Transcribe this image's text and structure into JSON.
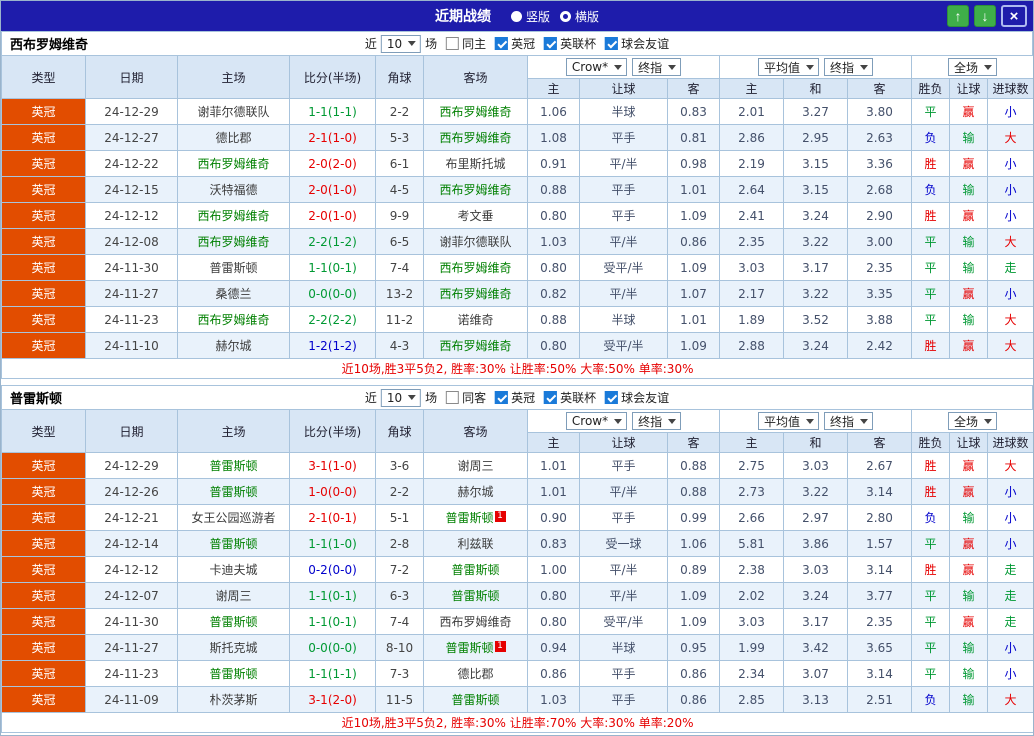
{
  "titlebar": {
    "title": "近期战绩",
    "options": [
      {
        "label": "竖版",
        "selected": false
      },
      {
        "label": "横版",
        "selected": true
      }
    ],
    "icons": {
      "up": "↑",
      "down": "↓",
      "close": "×"
    }
  },
  "table_header": {
    "type": "类型",
    "date": "日期",
    "home": "主场",
    "score": "比分(半场)",
    "corner": "角球",
    "away": "客场",
    "selects": {
      "asia_source": "Crow*",
      "asia_final": "终指",
      "euro_source": "平均值",
      "euro_final": "终指",
      "scope": "全场"
    },
    "sub": [
      "主",
      "让球",
      "客",
      "主",
      "和",
      "客",
      "胜负",
      "让球",
      "进球数"
    ]
  },
  "colors": {
    "titlebar_bg": "#1e1cab",
    "league_bg": "#e24d00",
    "header_bg": "#d8e6f5",
    "row_alt_bg": "#e9f2fb",
    "team_highlight": "#008000",
    "win_red": "#e60000",
    "draw_green": "#009933",
    "loss_blue": "#0000cc",
    "button_green": "#3fae49"
  },
  "sections": [
    {
      "team": "西布罗姆维奇",
      "filter": {
        "near": "近",
        "count": "10",
        "games": "场",
        "checkboxes": [
          {
            "label": "同主",
            "checked": false
          },
          {
            "label": "英冠",
            "checked": true
          },
          {
            "label": "英联杯",
            "checked": true
          },
          {
            "label": "球会友谊",
            "checked": true
          }
        ]
      },
      "rows": [
        {
          "league": "英冠",
          "date": "24-12-29",
          "home": "谢菲尔德联队",
          "home_hl": false,
          "score": "1-1(1-1)",
          "score_c": "g",
          "corner": "2-2",
          "away": "西布罗姆维奇",
          "away_hl": true,
          "asia": [
            "1.06",
            "半球",
            "0.83"
          ],
          "euro": [
            "2.01",
            "3.27",
            "3.80"
          ],
          "wdl": "平",
          "wdl_c": "g",
          "let": "赢",
          "let_c": "r",
          "goal": "小",
          "goal_c": "b"
        },
        {
          "league": "英冠",
          "date": "24-12-27",
          "home": "德比郡",
          "home_hl": false,
          "score": "2-1(1-0)",
          "score_c": "r",
          "corner": "5-3",
          "away": "西布罗姆维奇",
          "away_hl": true,
          "asia": [
            "1.08",
            "平手",
            "0.81"
          ],
          "euro": [
            "2.86",
            "2.95",
            "2.63"
          ],
          "wdl": "负",
          "wdl_c": "b",
          "let": "输",
          "let_c": "g",
          "goal": "大",
          "goal_c": "r"
        },
        {
          "league": "英冠",
          "date": "24-12-22",
          "home": "西布罗姆维奇",
          "home_hl": true,
          "score": "2-0(2-0)",
          "score_c": "r",
          "corner": "6-1",
          "away": "布里斯托城",
          "away_hl": false,
          "asia": [
            "0.91",
            "平/半",
            "0.98"
          ],
          "euro": [
            "2.19",
            "3.15",
            "3.36"
          ],
          "wdl": "胜",
          "wdl_c": "r",
          "let": "赢",
          "let_c": "r",
          "goal": "小",
          "goal_c": "b"
        },
        {
          "league": "英冠",
          "date": "24-12-15",
          "home": "沃特福德",
          "home_hl": false,
          "score": "2-0(1-0)",
          "score_c": "r",
          "corner": "4-5",
          "away": "西布罗姆维奇",
          "away_hl": true,
          "asia": [
            "0.88",
            "平手",
            "1.01"
          ],
          "euro": [
            "2.64",
            "3.15",
            "2.68"
          ],
          "wdl": "负",
          "wdl_c": "b",
          "let": "输",
          "let_c": "g",
          "goal": "小",
          "goal_c": "b"
        },
        {
          "league": "英冠",
          "date": "24-12-12",
          "home": "西布罗姆维奇",
          "home_hl": true,
          "score": "2-0(1-0)",
          "score_c": "r",
          "corner": "9-9",
          "away": "考文垂",
          "away_hl": false,
          "asia": [
            "0.80",
            "平手",
            "1.09"
          ],
          "euro": [
            "2.41",
            "3.24",
            "2.90"
          ],
          "wdl": "胜",
          "wdl_c": "r",
          "let": "赢",
          "let_c": "r",
          "goal": "小",
          "goal_c": "b"
        },
        {
          "league": "英冠",
          "date": "24-12-08",
          "home": "西布罗姆维奇",
          "home_hl": true,
          "score": "2-2(1-2)",
          "score_c": "g",
          "corner": "6-5",
          "away": "谢菲尔德联队",
          "away_hl": false,
          "asia": [
            "1.03",
            "平/半",
            "0.86"
          ],
          "euro": [
            "2.35",
            "3.22",
            "3.00"
          ],
          "wdl": "平",
          "wdl_c": "g",
          "let": "输",
          "let_c": "g",
          "goal": "大",
          "goal_c": "r"
        },
        {
          "league": "英冠",
          "date": "24-11-30",
          "home": "普雷斯顿",
          "home_hl": false,
          "score": "1-1(0-1)",
          "score_c": "g",
          "corner": "7-4",
          "away": "西布罗姆维奇",
          "away_hl": true,
          "asia": [
            "0.80",
            "受平/半",
            "1.09"
          ],
          "euro": [
            "3.03",
            "3.17",
            "2.35"
          ],
          "wdl": "平",
          "wdl_c": "g",
          "let": "输",
          "let_c": "g",
          "goal": "走",
          "goal_c": "g"
        },
        {
          "league": "英冠",
          "date": "24-11-27",
          "home": "桑德兰",
          "home_hl": false,
          "score": "0-0(0-0)",
          "score_c": "g",
          "corner": "13-2",
          "away": "西布罗姆维奇",
          "away_hl": true,
          "asia": [
            "0.82",
            "平/半",
            "1.07"
          ],
          "euro": [
            "2.17",
            "3.22",
            "3.35"
          ],
          "wdl": "平",
          "wdl_c": "g",
          "let": "赢",
          "let_c": "r",
          "goal": "小",
          "goal_c": "b"
        },
        {
          "league": "英冠",
          "date": "24-11-23",
          "home": "西布罗姆维奇",
          "home_hl": true,
          "score": "2-2(2-2)",
          "score_c": "g",
          "corner": "11-2",
          "away": "诺维奇",
          "away_hl": false,
          "asia": [
            "0.88",
            "半球",
            "1.01"
          ],
          "euro": [
            "1.89",
            "3.52",
            "3.88"
          ],
          "wdl": "平",
          "wdl_c": "g",
          "let": "输",
          "let_c": "g",
          "goal": "大",
          "goal_c": "r"
        },
        {
          "league": "英冠",
          "date": "24-11-10",
          "home": "赫尔城",
          "home_hl": false,
          "score": "1-2(1-2)",
          "score_c": "b",
          "corner": "4-3",
          "away": "西布罗姆维奇",
          "away_hl": true,
          "asia": [
            "0.80",
            "受平/半",
            "1.09"
          ],
          "euro": [
            "2.88",
            "3.24",
            "2.42"
          ],
          "wdl": "胜",
          "wdl_c": "r",
          "let": "赢",
          "let_c": "r",
          "goal": "大",
          "goal_c": "r"
        }
      ],
      "footer": "近10场,胜3平5负2, 胜率:30% 让胜率:50% 大率:50% 单率:30%"
    },
    {
      "team": "普雷斯顿",
      "filter": {
        "near": "近",
        "count": "10",
        "games": "场",
        "checkboxes": [
          {
            "label": "同客",
            "checked": false
          },
          {
            "label": "英冠",
            "checked": true
          },
          {
            "label": "英联杯",
            "checked": true
          },
          {
            "label": "球会友谊",
            "checked": true
          }
        ]
      },
      "rows": [
        {
          "league": "英冠",
          "date": "24-12-29",
          "home": "普雷斯顿",
          "home_hl": true,
          "score": "3-1(1-0)",
          "score_c": "r",
          "corner": "3-6",
          "away": "谢周三",
          "away_hl": false,
          "asia": [
            "1.01",
            "平手",
            "0.88"
          ],
          "euro": [
            "2.75",
            "3.03",
            "2.67"
          ],
          "wdl": "胜",
          "wdl_c": "r",
          "let": "赢",
          "let_c": "r",
          "goal": "大",
          "goal_c": "r"
        },
        {
          "league": "英冠",
          "date": "24-12-26",
          "home": "普雷斯顿",
          "home_hl": true,
          "score": "1-0(0-0)",
          "score_c": "r",
          "corner": "2-2",
          "away": "赫尔城",
          "away_hl": false,
          "asia": [
            "1.01",
            "平/半",
            "0.88"
          ],
          "euro": [
            "2.73",
            "3.22",
            "3.14"
          ],
          "wdl": "胜",
          "wdl_c": "r",
          "let": "赢",
          "let_c": "r",
          "goal": "小",
          "goal_c": "b"
        },
        {
          "league": "英冠",
          "date": "24-12-21",
          "home": "女王公园巡游者",
          "home_hl": false,
          "score": "2-1(0-1)",
          "score_c": "r",
          "corner": "5-1",
          "away": "普雷斯顿",
          "away_hl": true,
          "away_badge": "1",
          "asia": [
            "0.90",
            "平手",
            "0.99"
          ],
          "euro": [
            "2.66",
            "2.97",
            "2.80"
          ],
          "wdl": "负",
          "wdl_c": "b",
          "let": "输",
          "let_c": "g",
          "goal": "小",
          "goal_c": "b"
        },
        {
          "league": "英冠",
          "date": "24-12-14",
          "home": "普雷斯顿",
          "home_hl": true,
          "score": "1-1(1-0)",
          "score_c": "g",
          "corner": "2-8",
          "away": "利兹联",
          "away_hl": false,
          "asia": [
            "0.83",
            "受一球",
            "1.06"
          ],
          "euro": [
            "5.81",
            "3.86",
            "1.57"
          ],
          "wdl": "平",
          "wdl_c": "g",
          "let": "赢",
          "let_c": "r",
          "goal": "小",
          "goal_c": "b"
        },
        {
          "league": "英冠",
          "date": "24-12-12",
          "home": "卡迪夫城",
          "home_hl": false,
          "score": "0-2(0-0)",
          "score_c": "b",
          "corner": "7-2",
          "away": "普雷斯顿",
          "away_hl": true,
          "asia": [
            "1.00",
            "平/半",
            "0.89"
          ],
          "euro": [
            "2.38",
            "3.03",
            "3.14"
          ],
          "wdl": "胜",
          "wdl_c": "r",
          "let": "赢",
          "let_c": "r",
          "goal": "走",
          "goal_c": "g"
        },
        {
          "league": "英冠",
          "date": "24-12-07",
          "home": "谢周三",
          "home_hl": false,
          "score": "1-1(0-1)",
          "score_c": "g",
          "corner": "6-3",
          "away": "普雷斯顿",
          "away_hl": true,
          "asia": [
            "0.80",
            "平/半",
            "1.09"
          ],
          "euro": [
            "2.02",
            "3.24",
            "3.77"
          ],
          "wdl": "平",
          "wdl_c": "g",
          "let": "输",
          "let_c": "g",
          "goal": "走",
          "goal_c": "g"
        },
        {
          "league": "英冠",
          "date": "24-11-30",
          "home": "普雷斯顿",
          "home_hl": true,
          "score": "1-1(0-1)",
          "score_c": "g",
          "corner": "7-4",
          "away": "西布罗姆维奇",
          "away_hl": false,
          "asia": [
            "0.80",
            "受平/半",
            "1.09"
          ],
          "euro": [
            "3.03",
            "3.17",
            "2.35"
          ],
          "wdl": "平",
          "wdl_c": "g",
          "let": "赢",
          "let_c": "r",
          "goal": "走",
          "goal_c": "g"
        },
        {
          "league": "英冠",
          "date": "24-11-27",
          "home": "斯托克城",
          "home_hl": false,
          "score": "0-0(0-0)",
          "score_c": "g",
          "corner": "8-10",
          "away": "普雷斯顿",
          "away_hl": true,
          "away_badge": "1",
          "asia": [
            "0.94",
            "半球",
            "0.95"
          ],
          "euro": [
            "1.99",
            "3.42",
            "3.65"
          ],
          "wdl": "平",
          "wdl_c": "g",
          "let": "输",
          "let_c": "g",
          "goal": "小",
          "goal_c": "b"
        },
        {
          "league": "英冠",
          "date": "24-11-23",
          "home": "普雷斯顿",
          "home_hl": true,
          "score": "1-1(1-1)",
          "score_c": "g",
          "corner": "7-3",
          "away": "德比郡",
          "away_hl": false,
          "asia": [
            "0.86",
            "平手",
            "0.86"
          ],
          "euro": [
            "2.34",
            "3.07",
            "3.14"
          ],
          "wdl": "平",
          "wdl_c": "g",
          "let": "输",
          "let_c": "g",
          "goal": "小",
          "goal_c": "b"
        },
        {
          "league": "英冠",
          "date": "24-11-09",
          "home": "朴茨茅斯",
          "home_hl": false,
          "score": "3-1(2-0)",
          "score_c": "r",
          "corner": "11-5",
          "away": "普雷斯顿",
          "away_hl": true,
          "asia": [
            "1.03",
            "平手",
            "0.86"
          ],
          "euro": [
            "2.85",
            "3.13",
            "2.51"
          ],
          "wdl": "负",
          "wdl_c": "b",
          "let": "输",
          "let_c": "g",
          "goal": "大",
          "goal_c": "r"
        }
      ],
      "footer": "近10场,胜3平5负2, 胜率:30% 让胜率:70% 大率:30% 单率:20%"
    }
  ]
}
